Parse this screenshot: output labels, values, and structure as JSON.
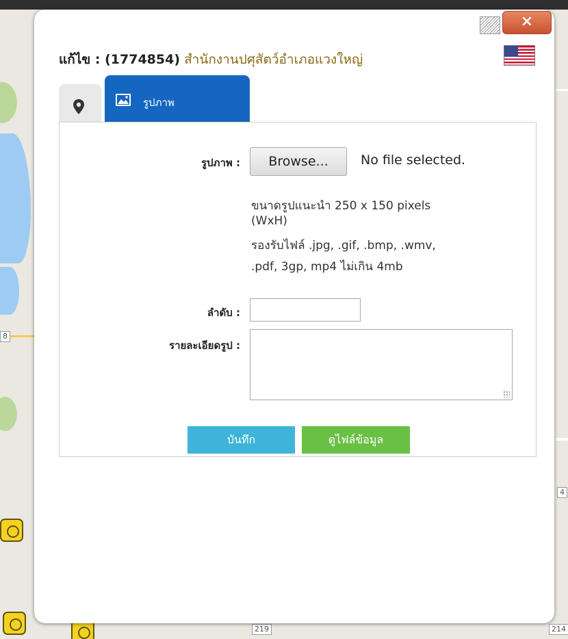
{
  "window": {
    "close_label": "×"
  },
  "header": {
    "prefix": "แก้ไข : (1774854)",
    "office_name": "สำนักงานปศุสัตว์อำเภอแวงใหญ่",
    "language_flag": "us-flag-icon"
  },
  "tabs": [
    {
      "icon": "location-pin-icon",
      "label": ""
    },
    {
      "icon": "image-icon",
      "label": "รูปภาพ",
      "active": true
    }
  ],
  "form": {
    "image_label": "รูปภาพ :",
    "browse_label": "Browse...",
    "file_status": "No file selected.",
    "hint_lines": [
      "ขนาดรูปแนะนำ 250 x 150 pixels",
      "(WxH)",
      "รองรับไฟล์ .jpg, .gif, .bmp, .wmv,",
      ".pdf, 3gp, mp4 ไม่เกิน 4mb"
    ],
    "order_label": "ลำดับ :",
    "order_value": "",
    "description_label": "รายละเอียดรูป :",
    "description_value": "",
    "save_label": "บันทึก",
    "view_files_label": "ดูไฟล์ข้อมูล"
  },
  "map": {
    "road_labels": [
      "219",
      "214",
      "4",
      "8"
    ]
  },
  "colors": {
    "tab_active": "#1566c0",
    "save_button": "#3eb4d8",
    "view_button": "#6abf45",
    "office_name": "#8a6a14",
    "close_button": "#c8522f"
  }
}
